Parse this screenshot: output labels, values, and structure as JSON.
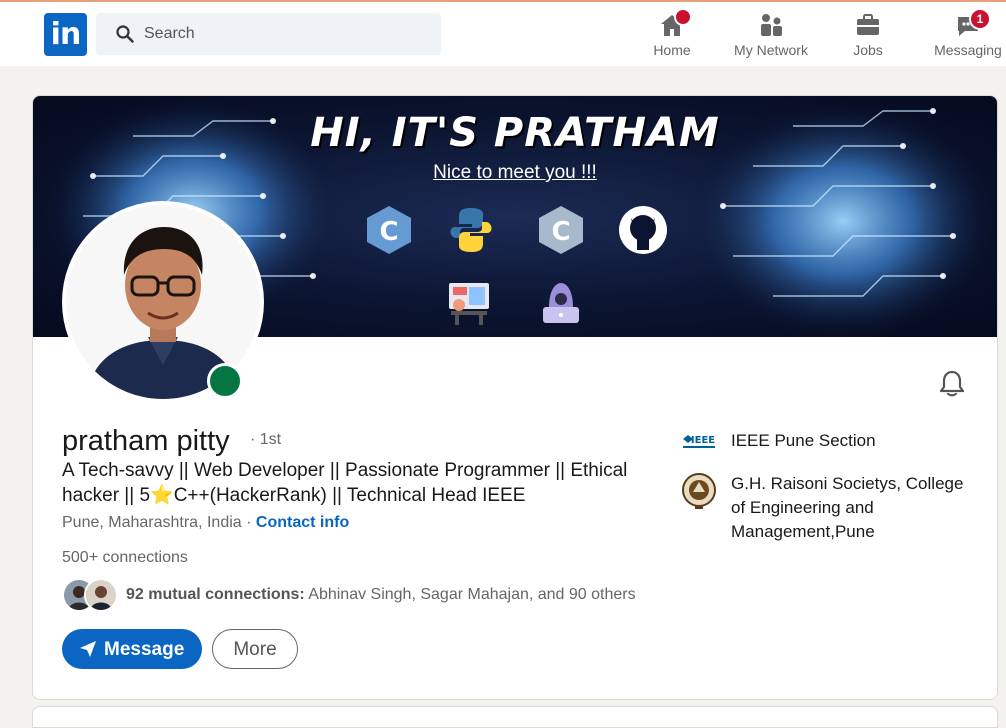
{
  "nav": {
    "logo": "in",
    "search_placeholder": "Search",
    "items": [
      {
        "label": "Home",
        "icon": "home-icon",
        "badge": ""
      },
      {
        "label": "My Network",
        "icon": "network-icon",
        "badge": ""
      },
      {
        "label": "Jobs",
        "icon": "briefcase-icon",
        "badge": ""
      },
      {
        "label": "Messaging",
        "icon": "messaging-icon",
        "badge": "1"
      }
    ]
  },
  "banner": {
    "title": "HI, IT'S PRATHAM",
    "subtitle": "Nice to meet you !!!",
    "tech_icons": [
      "c-plus-plus-icon",
      "python-icon",
      "c-icon",
      "github-icon",
      "coding-desk-icon",
      "hacker-laptop-icon"
    ]
  },
  "profile": {
    "name": "pratham pitty",
    "degree": "· 1st",
    "headline_part1": "A Tech-savvy || Web Developer || Passionate Programmer || Ethical hacker || 5",
    "headline_star": "⭐",
    "headline_part2": "C++(HackerRank) || Technical Head IEEE",
    "location": "Pune, Maharashtra, India",
    "location_sep": " · ",
    "contact_info": "Contact info",
    "connections_count": "500+",
    "connections_label": " connections",
    "mutual_bold": "92 mutual connections:",
    "mutual_names": " Abhinav Singh, Sagar Mahajan, and 90 others",
    "message_button": "Message",
    "more_button": "More"
  },
  "organizations": [
    {
      "name": "IEEE Pune Section",
      "icon": "ieee-logo-icon"
    },
    {
      "name": "G.H. Raisoni Societys, College of Engineering and Management,Pune",
      "icon": "raisoni-seal-icon"
    }
  ],
  "colors": {
    "brand": "#0a66c2",
    "online": "#057642",
    "badge": "#cb112d"
  }
}
